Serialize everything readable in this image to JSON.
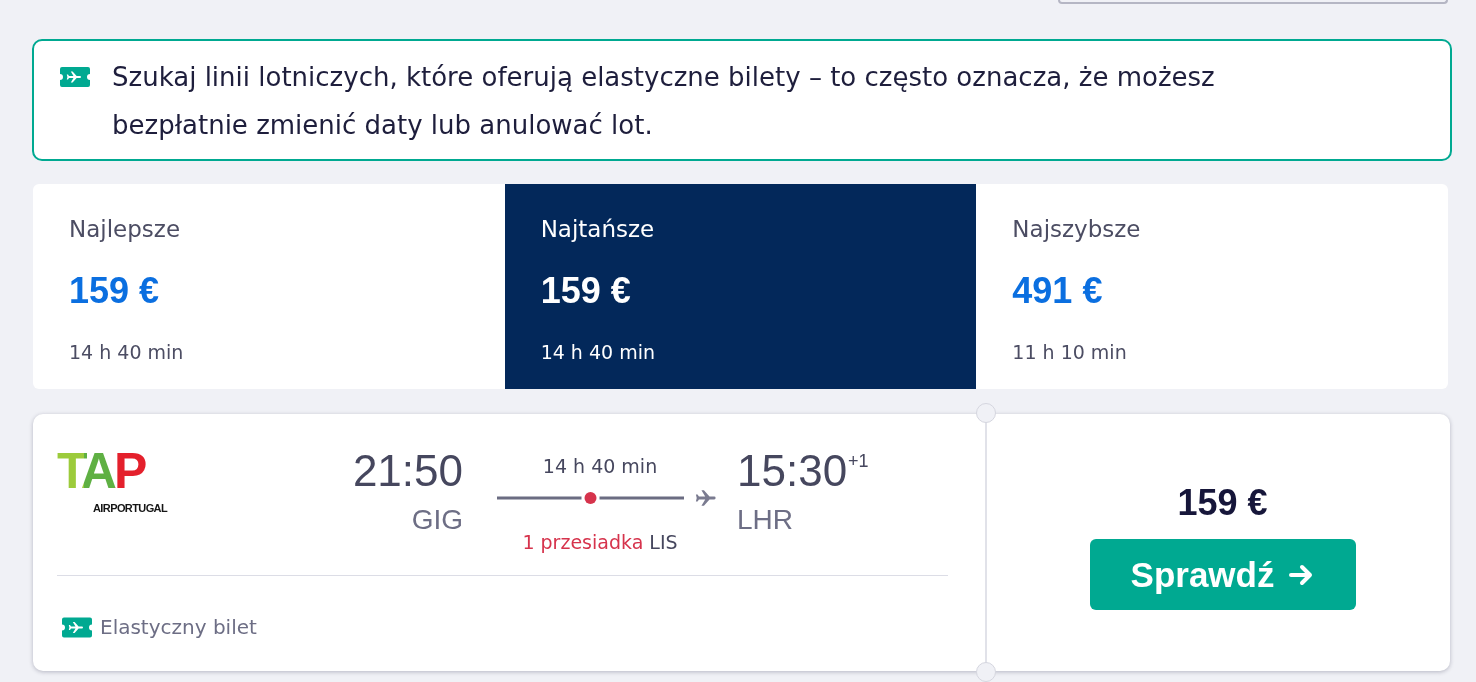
{
  "info_banner": {
    "text": "Szukaj linii lotniczych, które oferują elastyczne bilety – to często oznacza, że możesz bezpłatnie zmienić daty lub anulować lot."
  },
  "sort_tabs": [
    {
      "label": "Najlepsze",
      "price": "159 €",
      "duration": "14 h 40 min",
      "selected": false
    },
    {
      "label": "Najtańsze",
      "price": "159 €",
      "duration": "14 h 40 min",
      "selected": true
    },
    {
      "label": "Najszybsze",
      "price": "491 €",
      "duration": "11 h 10 min",
      "selected": false
    }
  ],
  "result": {
    "airline_logo": {
      "mark": "TAP",
      "wordmark": "AIRPORTUGAL"
    },
    "departure": {
      "time": "21:50",
      "airport": "GIG"
    },
    "duration": "14 h 40 min",
    "stops_label": "1 przesiadka",
    "stops": [
      {
        "airport": "LIS"
      }
    ],
    "arrival": {
      "time": "15:30",
      "day_offset": "+1",
      "airport": "LHR"
    },
    "features": [
      {
        "label": "Elastyczny bilet"
      }
    ],
    "price": "159 €",
    "button": "Sprawdź"
  }
}
